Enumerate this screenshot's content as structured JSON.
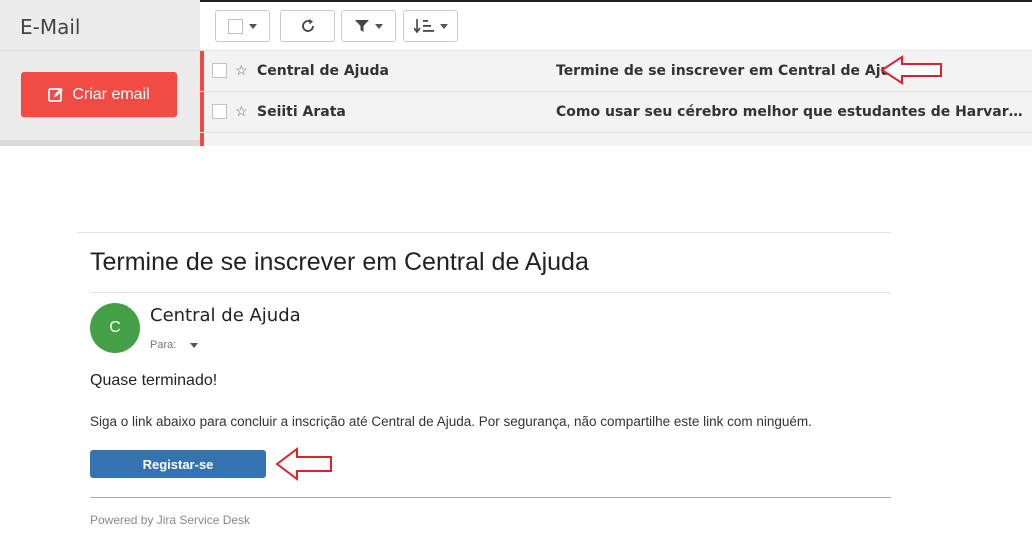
{
  "client": {
    "app_title": "E-Mail",
    "compose_label": "Criar email",
    "toolbar": {
      "select_icon": "checkbox-icon",
      "refresh_icon": "refresh-icon",
      "filter_icon": "filter-icon",
      "sort_icon": "sort-icon"
    },
    "rows": [
      {
        "sender": "Central de Ajuda",
        "subject": "Termine de se inscrever em Central de Ajuda"
      },
      {
        "sender": "Seiiti Arata",
        "subject": "Como usar seu cérebro melhor que estudantes de Harvard - com..."
      }
    ],
    "accent_color": "#f04b45"
  },
  "email": {
    "subject": "Termine de se inscrever em Central de Ajuda",
    "avatar_letter": "C",
    "from": "Central de Ajuda",
    "to_label": "Para:",
    "greeting": "Quase terminado!",
    "body": "Siga o link abaixo para concluir a inscrição até Central de Ajuda. Por segurança, não compartilhe este link com ninguém.",
    "cta_label": "Registar-se",
    "footer": "Powered by Jira Service Desk",
    "avatar_color": "#43a047",
    "button_color": "#3572b0"
  },
  "annotations": {
    "arrow_color": "#d9232d",
    "arrow_icon": "left-arrow-icon"
  }
}
